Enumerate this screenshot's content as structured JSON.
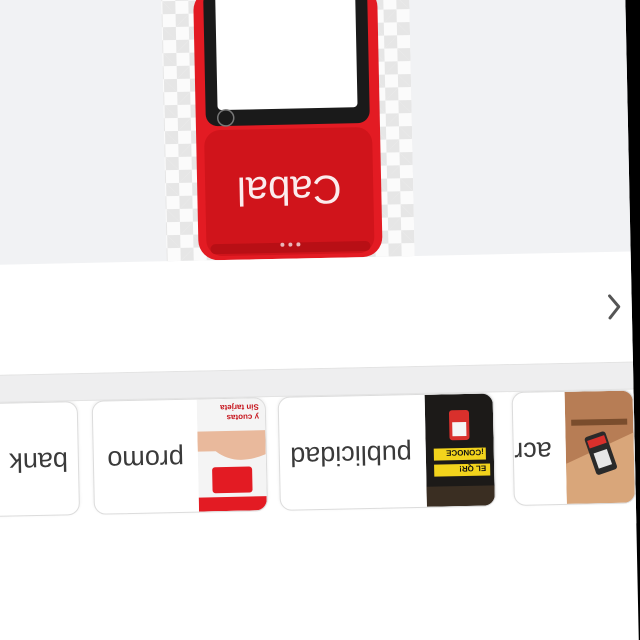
{
  "categories": {
    "items": [
      {
        "label": "acrilicos",
        "thumb_icon": "acrylic-stand-thumbnail"
      },
      {
        "label": "publicidad",
        "thumb_icon": "advertising-poster-thumbnail"
      },
      {
        "label": "promo",
        "thumb_icon": "promo-flyer-thumbnail"
      },
      {
        "label": "bank",
        "thumb_icon": "bank-thumbnail"
      }
    ]
  },
  "carousel": {
    "prev_icon": "chevron-left-icon"
  },
  "product": {
    "image_icon": "pos-terminal-image",
    "brand_text": "Cabal",
    "accent_color": "#e31b23"
  },
  "promo_card": {
    "lines": [
      "Sin tarjeta",
      "y cuotas"
    ]
  },
  "publicidad_card": {
    "lines": [
      "¡CONOCE",
      "EL QR!"
    ]
  }
}
